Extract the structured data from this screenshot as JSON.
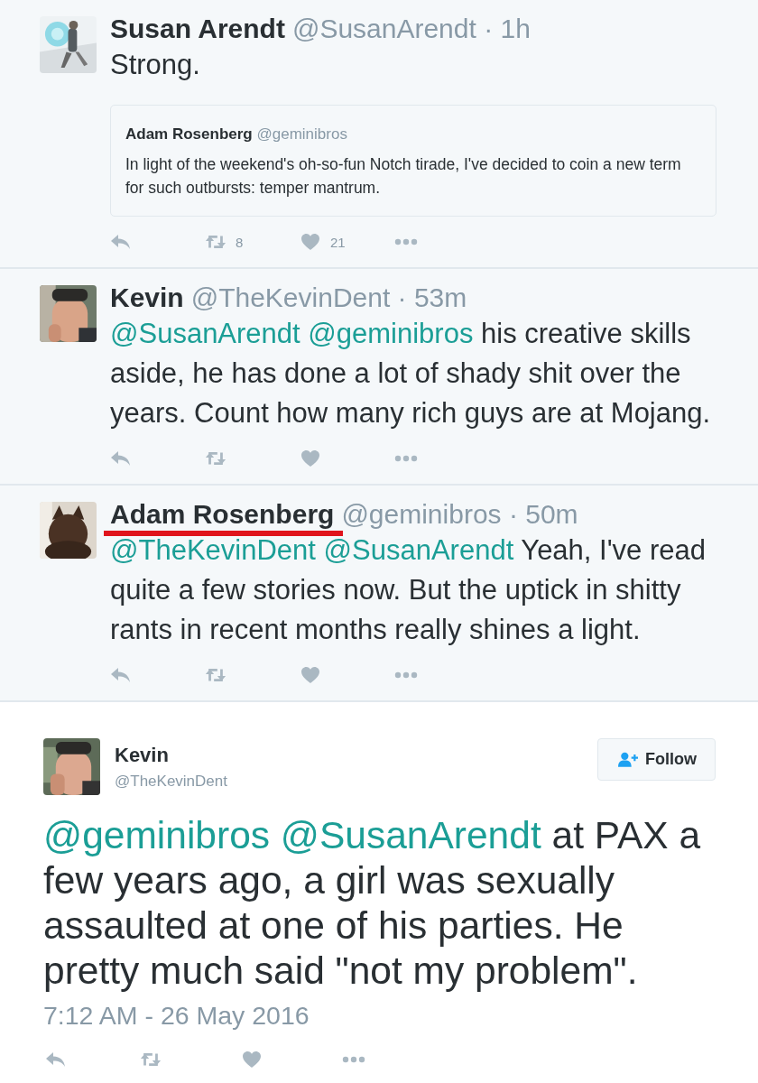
{
  "replies": [
    {
      "author": "Susan Arendt",
      "meta": "@SusanArendt · 1h",
      "underlined": false,
      "avatar": {
        "kind": "picture"
      },
      "text": [
        {
          "kind": "text",
          "text": "Strong."
        }
      ],
      "quote": {
        "author": "Adam Rosenberg",
        "handle": "@geminibros",
        "text": "In light of the weekend's oh-so-fun Notch tirade, I've decided to coin a new term for such outbursts: temper mantrum."
      },
      "actions": [
        {
          "kind": "reply"
        },
        {
          "kind": "retweet",
          "count": "8"
        },
        {
          "kind": "like",
          "count": "21"
        },
        {
          "kind": "more"
        }
      ]
    },
    {
      "author": "Kevin",
      "meta": "@TheKevinDent · 53m",
      "underlined": false,
      "avatar": {
        "kind": "picture"
      },
      "text": [
        {
          "kind": "mention",
          "text": "@SusanArendt"
        },
        {
          "kind": "mention",
          "text": "@geminibros"
        },
        {
          "kind": "text",
          "text": " his creative skills aside, he has done a lot of shady shit over the years. Count how many rich guys are at Mojang."
        }
      ],
      "actions": [
        {
          "kind": "reply"
        },
        {
          "kind": "retweet"
        },
        {
          "kind": "like"
        },
        {
          "kind": "more"
        }
      ]
    },
    {
      "author": "Adam Rosenberg",
      "meta": "@geminibros · 50m",
      "underlined": true,
      "avatar": {
        "kind": "picture"
      },
      "text": [
        {
          "kind": "mention",
          "text": "@TheKevinDent"
        },
        {
          "kind": "mention",
          "text": "@SusanArendt"
        },
        {
          "kind": "text",
          "text": " Yeah, I've read quite a few stories now. But the uptick in shitty rants in recent months really shines a light."
        }
      ],
      "actions": [
        {
          "kind": "reply"
        },
        {
          "kind": "retweet"
        },
        {
          "kind": "like"
        },
        {
          "kind": "more"
        }
      ]
    }
  ],
  "main_tweet": {
    "author": "Kevin",
    "handle": "@TheKevinDent",
    "avatar": {
      "kind": "picture"
    },
    "follow_button": "Follow",
    "text": [
      {
        "kind": "mention",
        "text": "@geminibros"
      },
      {
        "kind": "mention",
        "text": "@SusanArendt"
      },
      {
        "kind": "text",
        "text": " at PAX a few years ago, a girl was sexually assaulted at one of his parties. He pretty much said \"not my problem\"."
      }
    ],
    "timestamp": "7:12 AM - 26 May 2016",
    "actions": [
      {
        "kind": "reply"
      },
      {
        "kind": "retweet"
      },
      {
        "kind": "like"
      },
      {
        "kind": "more"
      }
    ]
  }
}
